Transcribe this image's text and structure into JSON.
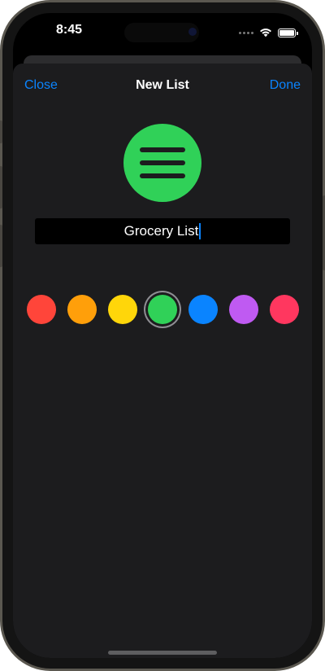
{
  "status_bar": {
    "time": "8:45",
    "icons": [
      "cellular-icon",
      "wifi-icon",
      "battery-icon"
    ]
  },
  "nav": {
    "close_label": "Close",
    "title": "New List",
    "done_label": "Done"
  },
  "list": {
    "icon": "list-icon",
    "icon_color": "#30d158",
    "name": "Grocery List"
  },
  "colors": {
    "selected": "green",
    "options": [
      {
        "name": "red",
        "hex": "#ff453a"
      },
      {
        "name": "orange",
        "hex": "#ff9f0a"
      },
      {
        "name": "yellow",
        "hex": "#ffd60a"
      },
      {
        "name": "green",
        "hex": "#30d158"
      },
      {
        "name": "blue",
        "hex": "#0a84ff"
      },
      {
        "name": "purple",
        "hex": "#bf5af2"
      },
      {
        "name": "pink",
        "hex": "#ff375f"
      }
    ]
  },
  "theme": {
    "accent": "#0a84ff",
    "sheet_background": "#1c1c1e"
  }
}
